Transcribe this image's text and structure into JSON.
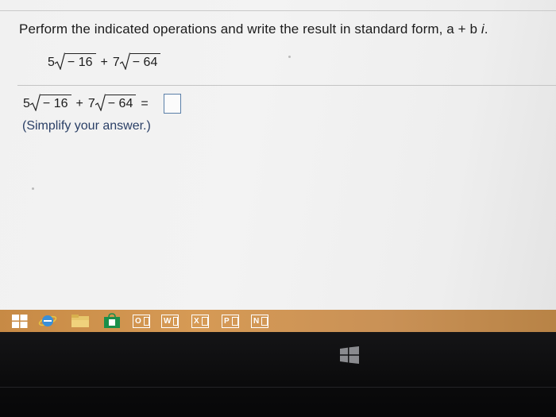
{
  "question": {
    "instruction_prefix": "Perform the indicated operations and write the result in standard form, a + b ",
    "instruction_var": "i",
    "instruction_suffix": "."
  },
  "expression": {
    "coef1": "5",
    "radicand1": "− 16",
    "plus": "+",
    "coef2": "7",
    "radicand2": "− 64"
  },
  "answer_row": {
    "coef1": "5",
    "radicand1": "− 16",
    "plus": "+",
    "coef2": "7",
    "radicand2": "− 64",
    "equals": "=",
    "answer_value": ""
  },
  "hint": "(Simplify your answer.)",
  "taskbar": {
    "icons": [
      "start-icon",
      "internet-explorer-icon",
      "file-explorer-icon",
      "store-icon",
      "outlook-icon",
      "word-icon",
      "excel-icon",
      "powerpoint-icon",
      "onenote-icon"
    ],
    "apps": {
      "outlook": "O",
      "word": "W",
      "excel": "X",
      "powerpoint": "P",
      "onenote": "N"
    },
    "colors": {
      "taskbar": "#c78a45",
      "tile_outline": "#ffffff"
    }
  },
  "colors": {
    "answer_box_border": "#5a7fa8",
    "hint_text": "#2a3f66"
  }
}
